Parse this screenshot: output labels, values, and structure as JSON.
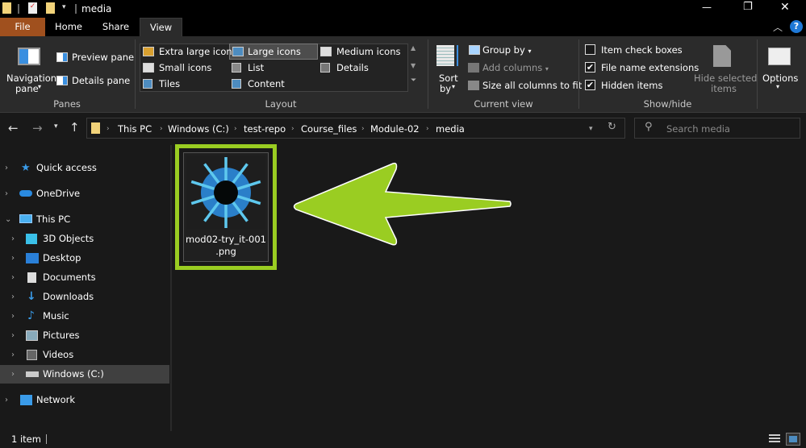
{
  "window": {
    "title": "media",
    "minimize": "—",
    "maximize": "❐",
    "close": "✕"
  },
  "tabs": [
    {
      "label": "File"
    },
    {
      "label": "Home"
    },
    {
      "label": "Share"
    },
    {
      "label": "View"
    }
  ],
  "ribbon": {
    "panes": {
      "label": "Panes",
      "navigation_pane": "Navigation",
      "navigation_pane2": "pane",
      "preview_pane": "Preview pane",
      "details_pane": "Details pane"
    },
    "layout": {
      "label": "Layout",
      "options": [
        "Extra large icons",
        "Large icons",
        "Medium icons",
        "Small icons",
        "List",
        "Details",
        "Tiles",
        "Content"
      ],
      "selected": "Large icons"
    },
    "current_view": {
      "label": "Current view",
      "sort_by": "Sort",
      "sort_by2": "by",
      "group_by": "Group by",
      "add_columns": "Add columns",
      "size_columns": "Size all columns to fit"
    },
    "show_hide": {
      "label": "Show/hide",
      "item_check_boxes": {
        "label": "Item check boxes",
        "checked": false
      },
      "file_name_extensions": {
        "label": "File name extensions",
        "checked": true
      },
      "hidden_items": {
        "label": "Hidden items",
        "checked": true
      },
      "hide_selected": "Hide selected",
      "hide_selected2": "items"
    },
    "options": {
      "label": "Options"
    }
  },
  "address": {
    "crumbs": [
      "This PC",
      "Windows (C:)",
      "test-repo",
      "Course_files",
      "Module-02",
      "media"
    ],
    "search_placeholder": "Search media"
  },
  "nav": [
    {
      "label": "Quick access",
      "level": 0
    },
    {
      "label": "OneDrive",
      "level": 0
    },
    {
      "label": "This PC",
      "level": 0,
      "expanded": true
    },
    {
      "label": "3D Objects",
      "level": 1
    },
    {
      "label": "Desktop",
      "level": 1
    },
    {
      "label": "Documents",
      "level": 1
    },
    {
      "label": "Downloads",
      "level": 1
    },
    {
      "label": "Music",
      "level": 1
    },
    {
      "label": "Pictures",
      "level": 1
    },
    {
      "label": "Videos",
      "level": 1
    },
    {
      "label": "Windows (C:)",
      "level": 1,
      "selected": true
    },
    {
      "label": "Network",
      "level": 0
    }
  ],
  "files": [
    {
      "name1": "mod02-try_it-001",
      "name2": ".png"
    }
  ],
  "status": {
    "count": "1 item"
  },
  "colors": {
    "accent_file_tab": "#a0501e",
    "highlight": "#9acd22",
    "icon_blue": "#2a7fc9",
    "ray": "#5ec8ee"
  }
}
